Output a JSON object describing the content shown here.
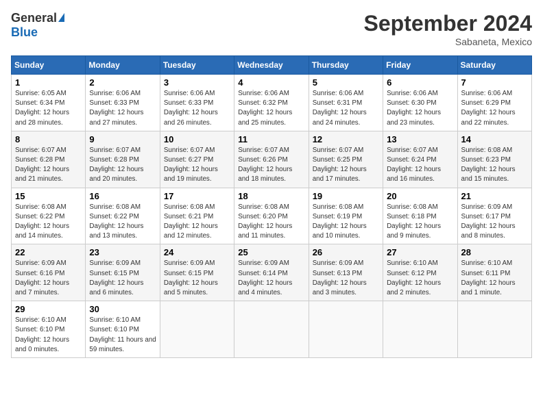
{
  "header": {
    "logo_general": "General",
    "logo_blue": "Blue",
    "month_title": "September 2024",
    "location": "Sabaneta, Mexico"
  },
  "days_of_week": [
    "Sunday",
    "Monday",
    "Tuesday",
    "Wednesday",
    "Thursday",
    "Friday",
    "Saturday"
  ],
  "weeks": [
    [
      {
        "day": "1",
        "sunrise": "6:05 AM",
        "sunset": "6:34 PM",
        "daylight": "12 hours and 28 minutes."
      },
      {
        "day": "2",
        "sunrise": "6:06 AM",
        "sunset": "6:33 PM",
        "daylight": "12 hours and 27 minutes."
      },
      {
        "day": "3",
        "sunrise": "6:06 AM",
        "sunset": "6:33 PM",
        "daylight": "12 hours and 26 minutes."
      },
      {
        "day": "4",
        "sunrise": "6:06 AM",
        "sunset": "6:32 PM",
        "daylight": "12 hours and 25 minutes."
      },
      {
        "day": "5",
        "sunrise": "6:06 AM",
        "sunset": "6:31 PM",
        "daylight": "12 hours and 24 minutes."
      },
      {
        "day": "6",
        "sunrise": "6:06 AM",
        "sunset": "6:30 PM",
        "daylight": "12 hours and 23 minutes."
      },
      {
        "day": "7",
        "sunrise": "6:06 AM",
        "sunset": "6:29 PM",
        "daylight": "12 hours and 22 minutes."
      }
    ],
    [
      {
        "day": "8",
        "sunrise": "6:07 AM",
        "sunset": "6:28 PM",
        "daylight": "12 hours and 21 minutes."
      },
      {
        "day": "9",
        "sunrise": "6:07 AM",
        "sunset": "6:28 PM",
        "daylight": "12 hours and 20 minutes."
      },
      {
        "day": "10",
        "sunrise": "6:07 AM",
        "sunset": "6:27 PM",
        "daylight": "12 hours and 19 minutes."
      },
      {
        "day": "11",
        "sunrise": "6:07 AM",
        "sunset": "6:26 PM",
        "daylight": "12 hours and 18 minutes."
      },
      {
        "day": "12",
        "sunrise": "6:07 AM",
        "sunset": "6:25 PM",
        "daylight": "12 hours and 17 minutes."
      },
      {
        "day": "13",
        "sunrise": "6:07 AM",
        "sunset": "6:24 PM",
        "daylight": "12 hours and 16 minutes."
      },
      {
        "day": "14",
        "sunrise": "6:08 AM",
        "sunset": "6:23 PM",
        "daylight": "12 hours and 15 minutes."
      }
    ],
    [
      {
        "day": "15",
        "sunrise": "6:08 AM",
        "sunset": "6:22 PM",
        "daylight": "12 hours and 14 minutes."
      },
      {
        "day": "16",
        "sunrise": "6:08 AM",
        "sunset": "6:22 PM",
        "daylight": "12 hours and 13 minutes."
      },
      {
        "day": "17",
        "sunrise": "6:08 AM",
        "sunset": "6:21 PM",
        "daylight": "12 hours and 12 minutes."
      },
      {
        "day": "18",
        "sunrise": "6:08 AM",
        "sunset": "6:20 PM",
        "daylight": "12 hours and 11 minutes."
      },
      {
        "day": "19",
        "sunrise": "6:08 AM",
        "sunset": "6:19 PM",
        "daylight": "12 hours and 10 minutes."
      },
      {
        "day": "20",
        "sunrise": "6:08 AM",
        "sunset": "6:18 PM",
        "daylight": "12 hours and 9 minutes."
      },
      {
        "day": "21",
        "sunrise": "6:09 AM",
        "sunset": "6:17 PM",
        "daylight": "12 hours and 8 minutes."
      }
    ],
    [
      {
        "day": "22",
        "sunrise": "6:09 AM",
        "sunset": "6:16 PM",
        "daylight": "12 hours and 7 minutes."
      },
      {
        "day": "23",
        "sunrise": "6:09 AM",
        "sunset": "6:15 PM",
        "daylight": "12 hours and 6 minutes."
      },
      {
        "day": "24",
        "sunrise": "6:09 AM",
        "sunset": "6:15 PM",
        "daylight": "12 hours and 5 minutes."
      },
      {
        "day": "25",
        "sunrise": "6:09 AM",
        "sunset": "6:14 PM",
        "daylight": "12 hours and 4 minutes."
      },
      {
        "day": "26",
        "sunrise": "6:09 AM",
        "sunset": "6:13 PM",
        "daylight": "12 hours and 3 minutes."
      },
      {
        "day": "27",
        "sunrise": "6:10 AM",
        "sunset": "6:12 PM",
        "daylight": "12 hours and 2 minutes."
      },
      {
        "day": "28",
        "sunrise": "6:10 AM",
        "sunset": "6:11 PM",
        "daylight": "12 hours and 1 minute."
      }
    ],
    [
      {
        "day": "29",
        "sunrise": "6:10 AM",
        "sunset": "6:10 PM",
        "daylight": "12 hours and 0 minutes."
      },
      {
        "day": "30",
        "sunrise": "6:10 AM",
        "sunset": "6:10 PM",
        "daylight": "11 hours and 59 minutes."
      },
      null,
      null,
      null,
      null,
      null
    ]
  ]
}
